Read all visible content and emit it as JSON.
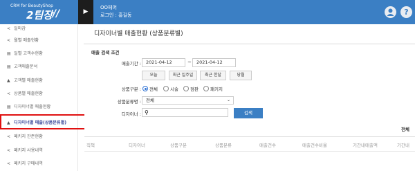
{
  "header": {
    "brand_small": "CRM for BeautyShop",
    "brand_big": "2팀장",
    "brand_mark": "//",
    "toggle_glyph": "▶",
    "shop_name": "OO헤어",
    "login_info": "로그인 : 홍길동",
    "user_icon": "person-icon",
    "help_icon": "?"
  },
  "sidebar": {
    "items": [
      {
        "icon": "share-icon",
        "glyph": "<",
        "label": "일마감"
      },
      {
        "icon": "share-icon",
        "glyph": "<",
        "label": "월별 매출현황"
      },
      {
        "icon": "list-icon",
        "glyph": "▤",
        "label": "일별 고객수현황"
      },
      {
        "icon": "list-icon",
        "glyph": "▤",
        "label": "고객매출분석"
      },
      {
        "icon": "person-icon",
        "glyph": "▲",
        "label": "고객별 매출현황"
      },
      {
        "icon": "share-icon",
        "glyph": "<",
        "label": "상품별 매출현황"
      },
      {
        "icon": "list-icon",
        "glyph": "▤",
        "label": "디자이너별 매출현황"
      },
      {
        "icon": "person-icon",
        "glyph": "▲",
        "label": "디자이너별 매출(상품분류별)"
      },
      {
        "icon": "share-icon",
        "glyph": "<",
        "label": "패키지 잔존현황"
      },
      {
        "icon": "share-icon",
        "glyph": "<",
        "label": "패키지 사용내역"
      },
      {
        "icon": "share-icon",
        "glyph": "<",
        "label": "패키지 구매내역"
      }
    ]
  },
  "main": {
    "page_title": "디자이너별 매출현황 (상품분류별)",
    "search": {
      "title": "매출 검색 조건",
      "period_label": "매출기간 :",
      "date_from": "2021-04-12",
      "date_sep": "~",
      "date_to": "2021-04-12",
      "quick_buttons": [
        "오늘",
        "최근 일주일",
        "최근 한달",
        "당월"
      ],
      "product_type_label": "상품구분 :",
      "product_types": [
        "전체",
        "시술",
        "점판",
        "패키지"
      ],
      "product_type_selected": "전체",
      "category_label": "상품분류명 :",
      "category_value": "전체",
      "designer_label": "디자이너 :",
      "designer_value": "",
      "search_button": "검색"
    },
    "total_label": "전체",
    "table": {
      "columns": [
        "직책",
        "디자이너",
        "상품구분",
        "상품분류",
        "매출건수",
        "매출건수비율",
        "기간내매출액",
        "기간내"
      ]
    }
  },
  "colors": {
    "header_blue": "#3b7fc4",
    "toggle_dark": "#1d1d1d",
    "highlight_red": "#e01010"
  }
}
